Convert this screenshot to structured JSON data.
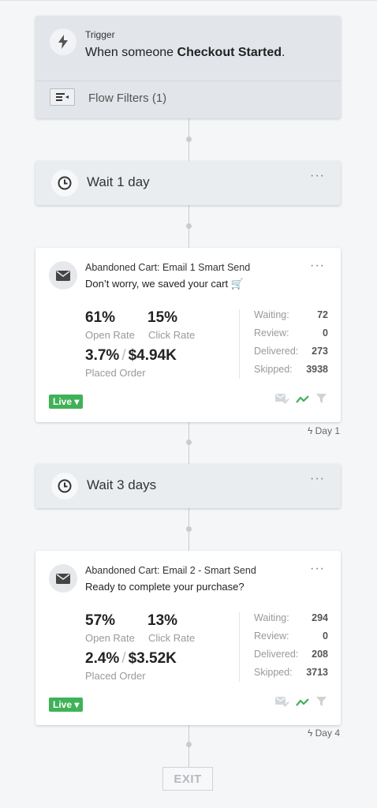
{
  "trigger": {
    "label": "Trigger",
    "desc_prefix": "When someone ",
    "desc_event": "Checkout Started",
    "desc_suffix": ".",
    "filters_label": "Flow Filters (1)"
  },
  "wait1": {
    "label": "Wait 1 day",
    "more": "···"
  },
  "email1": {
    "name": "Abandoned Cart: Email 1 Smart Send",
    "subject": "Don’t worry, we saved your cart 🛒",
    "open_rate": "61%",
    "open_rate_label": "Open Rate",
    "click_rate": "15%",
    "click_rate_label": "Click Rate",
    "placed_pct": "3.7%",
    "placed_slash": "/",
    "placed_value": "$4.94K",
    "placed_label": "Placed Order",
    "counts": [
      {
        "k": "Waiting:",
        "v": "72"
      },
      {
        "k": "Review:",
        "v": "0"
      },
      {
        "k": "Delivered:",
        "v": "273"
      },
      {
        "k": "Skipped:",
        "v": "3938"
      }
    ],
    "status": "Live ▾",
    "more": "···",
    "day_tag": "Day 1"
  },
  "wait2": {
    "label": "Wait 3 days",
    "more": "···"
  },
  "email2": {
    "name": "Abandoned Cart: Email 2 - Smart Send",
    "subject": "Ready to complete your purchase?",
    "open_rate": "57%",
    "open_rate_label": "Open Rate",
    "click_rate": "13%",
    "click_rate_label": "Click Rate",
    "placed_pct": "2.4%",
    "placed_slash": "/",
    "placed_value": "$3.52K",
    "placed_label": "Placed Order",
    "counts": [
      {
        "k": "Waiting:",
        "v": "294"
      },
      {
        "k": "Review:",
        "v": "0"
      },
      {
        "k": "Delivered:",
        "v": "208"
      },
      {
        "k": "Skipped:",
        "v": "3713"
      }
    ],
    "status": "Live ▾",
    "more": "···",
    "day_tag": "Day 4"
  },
  "exit": {
    "label": "EXIT"
  },
  "colors": {
    "live": "#3fb257",
    "accent_green": "#3fb257",
    "card_grey": "#e9edf0"
  }
}
